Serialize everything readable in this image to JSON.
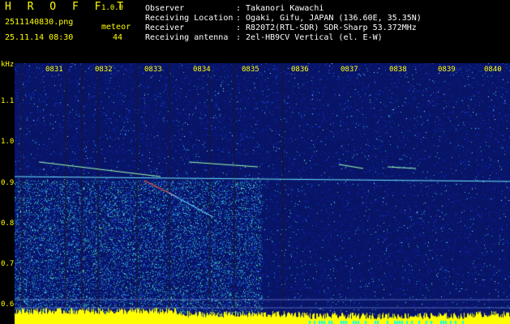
{
  "app": {
    "name": "H R O F F T",
    "version": "1.0.0"
  },
  "capture": {
    "filename": "2511140830.png",
    "datetime": "25.11.14 08:30",
    "meteor_label": "meteor",
    "meteor_count": "44"
  },
  "station": {
    "observer_label": "Observer",
    "observer_value": ": Takanori Kawachi",
    "location_label": "Receiving Location",
    "location_value": ": Ogaki, Gifu, JAPAN (136.60E, 35.35N)",
    "receiver_label": "Receiver",
    "receiver_value": ": R820T2(RTL-SDR) SDR-Sharp 53.372MHz",
    "antenna_label": "Receiving antenna",
    "antenna_value": ": 2el-HB9CV Vertical (el. E-W)"
  },
  "axis": {
    "unit": "kHz",
    "time_ticks": [
      "0831",
      "0832",
      "0833",
      "0834",
      "0835",
      "0836",
      "0837",
      "0838",
      "0839",
      "0840"
    ],
    "freq_ticks": [
      "1.1",
      "1.0",
      "0.9",
      "0.8",
      "0.7",
      "0.6"
    ]
  },
  "colors": {
    "background": "#000000",
    "label_yellow": "#ffff00",
    "label_white": "#ffffff",
    "label_green": "#00ff66",
    "noise_floor": "#0a1a8c",
    "signal_hot": "#ff3030",
    "baseline_fill": "#ffff00"
  }
}
